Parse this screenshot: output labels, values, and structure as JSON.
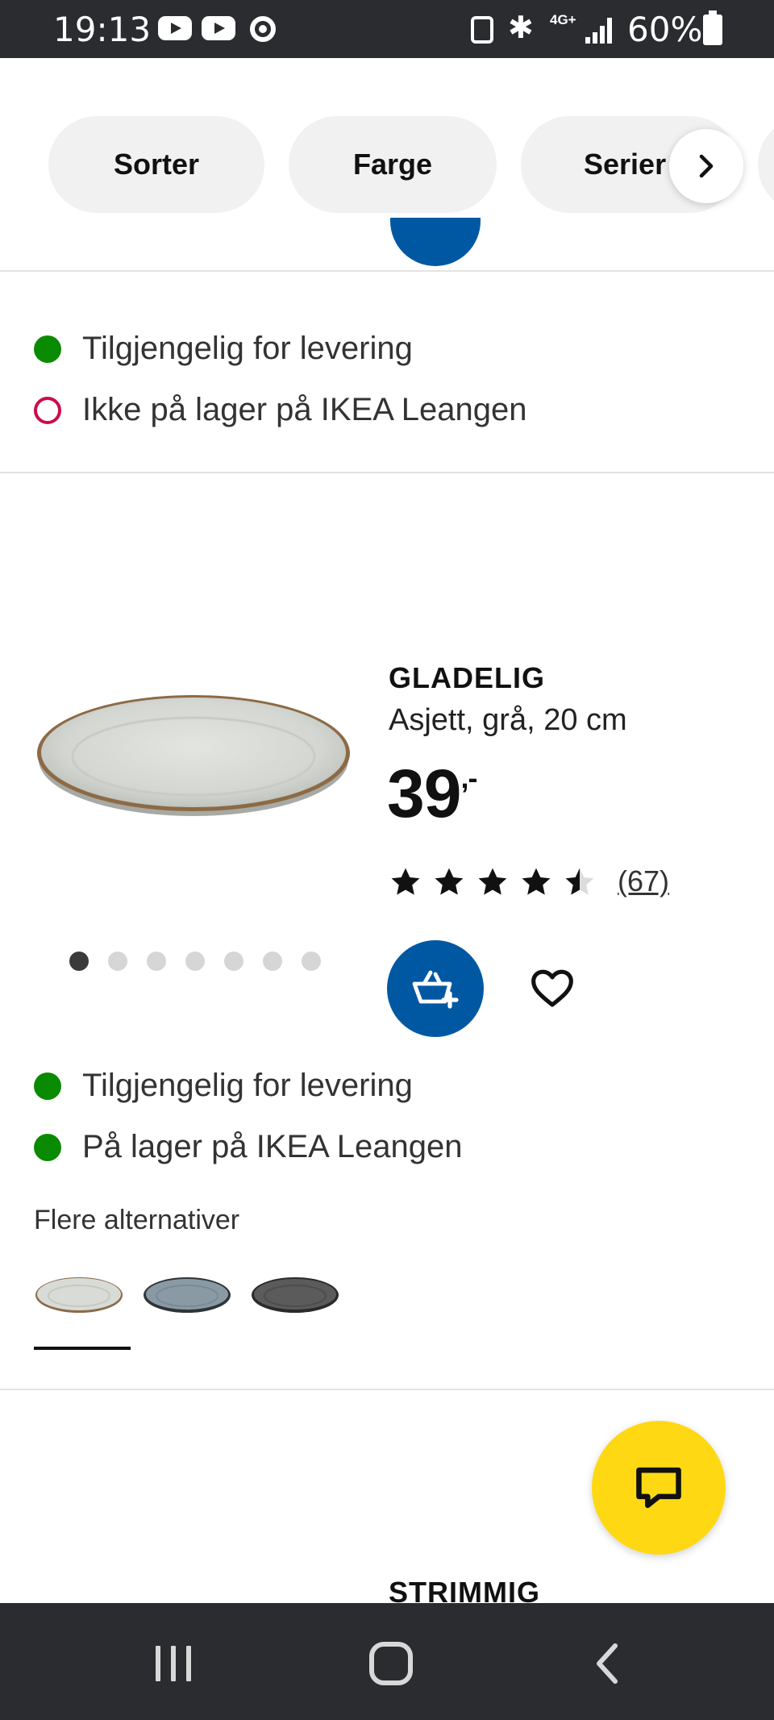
{
  "status_bar": {
    "time": "19:13",
    "network": "4G+",
    "battery": "60%",
    "icons": [
      "youtube-icon",
      "youtube-icon",
      "chrome-icon",
      "recycle-icon",
      "bluetooth-icon",
      "signal-icon",
      "battery-icon"
    ]
  },
  "filters": {
    "pills": [
      "Sorter",
      "Farge",
      "Serier"
    ],
    "scroll_icon": "chevron-right-icon"
  },
  "prev_product": {
    "availability": [
      {
        "text": "Tilgjengelig for levering",
        "status": "available",
        "color": "#0a8a00"
      },
      {
        "text": "Ikke på lager på IKEA Leangen",
        "status": "unavailable",
        "color": "#cc0d4a"
      }
    ]
  },
  "product": {
    "name": "GLADELIG",
    "description": "Asjett, grå, 20 cm",
    "price_main": "39",
    "price_suffix": ",-",
    "rating": 4.5,
    "rating_max": 5,
    "reviews": "(67)",
    "image_count": 7,
    "image_active": 1,
    "availability": [
      {
        "text": "Tilgjengelig for levering",
        "status": "available",
        "color": "#0a8a00"
      },
      {
        "text": "På lager på IKEA Leangen",
        "status": "available",
        "color": "#0a8a00"
      }
    ],
    "more_options_title": "Flere alternativer",
    "variants": [
      "grey-plate",
      "blue-grey-plate",
      "dark-grey-plate"
    ],
    "selected_variant": 1
  },
  "next_product": {
    "name": "STRIMMIG"
  },
  "colors": {
    "ikea_blue": "#0058a3",
    "chat_yellow": "#ffd814",
    "in_stock_green": "#0a8a00",
    "out_of_stock_red": "#cc0d4a"
  }
}
